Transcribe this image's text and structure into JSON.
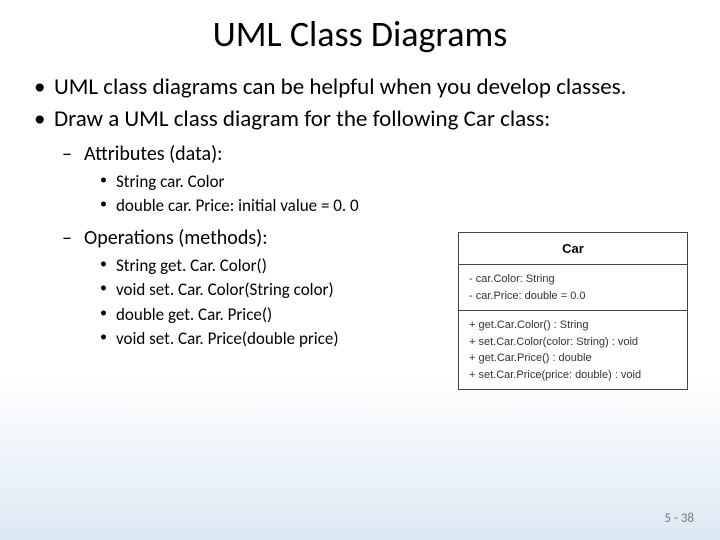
{
  "slide": {
    "title": "UML Class Diagrams",
    "bullets": [
      "UML class diagrams can  be helpful when you develop classes.",
      "Draw a UML class diagram for the following Car class:"
    ],
    "sub1_label": "Attributes (data):",
    "sub1_items": [
      "String car. Color",
      "double car. Price: initial value = 0. 0"
    ],
    "sub2_label": "Operations (methods):",
    "sub2_items": [
      "String get. Car. Color()",
      "void set. Car. Color(String color)",
      "double get. Car. Price()",
      "void set. Car. Price(double price)"
    ],
    "page_number": "5 - 38"
  },
  "uml": {
    "class_name": "Car",
    "attributes": [
      "- car.Color: String",
      "- car.Price: double = 0.0"
    ],
    "operations": [
      "+ get.Car.Color() : String",
      "+ set.Car.Color(color: String) : void",
      "+ get.Car.Price() : double",
      "+ set.Car.Price(price: double) : void"
    ]
  }
}
